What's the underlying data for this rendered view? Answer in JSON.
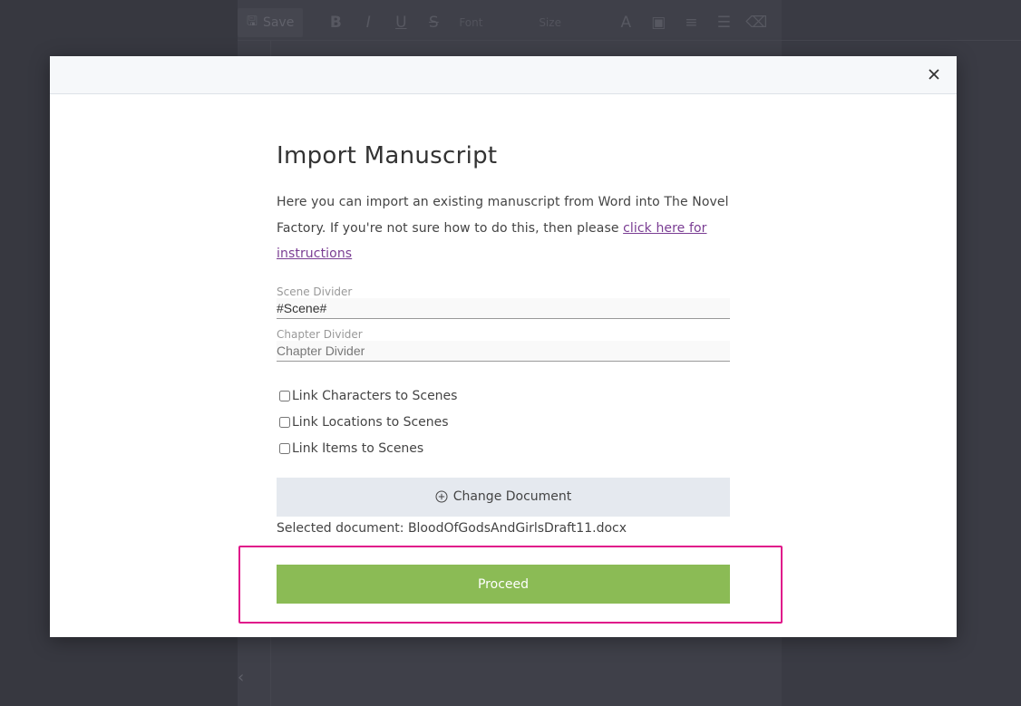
{
  "background": {
    "toolbar": {
      "save_label": "Save",
      "font_placeholder": "Font",
      "size_placeholder": "Size"
    }
  },
  "modal": {
    "close_label": "×",
    "title": "Import Manuscript",
    "intro_text": "Here you can import an existing manuscript from Word into The Novel Factory. If you're not sure how to do this, then please ",
    "intro_link": "click here for instructions",
    "scene_divider": {
      "label": "Scene Divider",
      "value": "#Scene#"
    },
    "chapter_divider": {
      "label": "Chapter Divider",
      "placeholder": "Chapter Divider"
    },
    "checkboxes": [
      {
        "label": "Link Characters to Scenes",
        "checked": false
      },
      {
        "label": "Link Locations to Scenes",
        "checked": false
      },
      {
        "label": "Link Items to Scenes",
        "checked": false
      }
    ],
    "change_document_label": "Change Document",
    "selected_document_text": "Selected document: BloodOfGodsAndGirlsDraft11.docx",
    "proceed_label": "Proceed"
  },
  "colors": {
    "proceed": "#8bbb55",
    "highlight": "#e0168a",
    "link": "#7a3d93"
  }
}
